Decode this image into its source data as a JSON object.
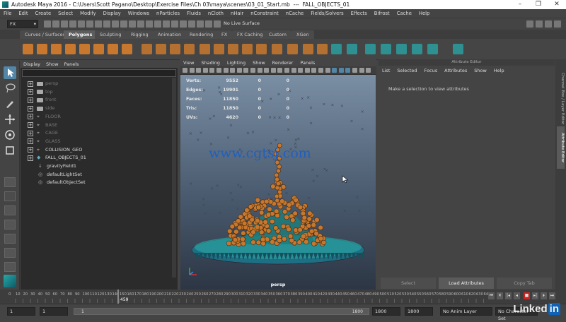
{
  "titlebar": {
    "app": "Autodesk Maya 2016",
    "sep": "-",
    "path": "C:\\Users\\Scott Pagano\\Desktop\\Exercise Files\\Ch 03\\maya\\scenes\\03_01_Start.mb",
    "dash": "---",
    "object": "FALL_OBJECTS_01"
  },
  "menubar": [
    "File",
    "Edit",
    "Create",
    "Select",
    "Modify",
    "Display",
    "Windows",
    "nParticles",
    "Fluids",
    "nCloth",
    "nHair",
    "nConstraint",
    "nCache",
    "Fields/Solvers",
    "Effects",
    "Bifrost",
    "Cache",
    "Help"
  ],
  "statusline": {
    "menuset": "FX",
    "live_surface": "No Live Surface"
  },
  "shelf_tabs": [
    "Curves / Surfaces",
    "Polygons",
    "Sculpting",
    "Rigging",
    "Animation",
    "Rendering",
    "FX",
    "FX Caching",
    "Custom",
    "XGen"
  ],
  "active_shelf_tab": "Polygons",
  "outliner": {
    "menu": [
      "Display",
      "Show",
      "Panels"
    ],
    "items": [
      {
        "label": "persp",
        "dim": true,
        "kind": "camera"
      },
      {
        "label": "top",
        "dim": true,
        "kind": "camera"
      },
      {
        "label": "front",
        "dim": true,
        "kind": "camera"
      },
      {
        "label": "side",
        "dim": true,
        "kind": "camera"
      },
      {
        "label": "FLOOR",
        "dim": true,
        "kind": "group"
      },
      {
        "label": "BASE",
        "dim": true,
        "kind": "group"
      },
      {
        "label": "CAGE",
        "dim": true,
        "kind": "group"
      },
      {
        "label": "GLASS",
        "dim": true,
        "kind": "group"
      },
      {
        "label": "COLLISION_GEO",
        "dim": false,
        "kind": "group"
      },
      {
        "label": "FALL_OBJECTS_01",
        "dim": false,
        "kind": "mesh"
      },
      {
        "label": "gravityField1",
        "dim": false,
        "kind": "field"
      },
      {
        "label": "defaultLightSet",
        "dim": false,
        "kind": "set"
      },
      {
        "label": "defaultObjectSet",
        "dim": false,
        "kind": "set"
      }
    ]
  },
  "viewport": {
    "menu": [
      "View",
      "Shading",
      "Lighting",
      "Show",
      "Renderer",
      "Panels"
    ],
    "hud": [
      {
        "label": "Verts:",
        "v1": "9552",
        "v2": "0",
        "v3": "0"
      },
      {
        "label": "Edges:",
        "v1": "19901",
        "v2": "0",
        "v3": "0"
      },
      {
        "label": "Faces:",
        "v1": "11850",
        "v2": "0",
        "v3": "0"
      },
      {
        "label": "Tris:",
        "v1": "11850",
        "v2": "0",
        "v3": "0"
      },
      {
        "label": "UVs:",
        "v1": "4620",
        "v2": "0",
        "v3": "0"
      }
    ],
    "camera": "persp",
    "watermark": "www.cgtsj.com"
  },
  "attribute_editor": {
    "title": "Attribute Editor",
    "menu": [
      "List",
      "Selected",
      "Focus",
      "Attributes",
      "Show",
      "Help"
    ],
    "message": "Make a selection to view attributes",
    "buttons": [
      "Select",
      "Load Attributes",
      "Copy Tab"
    ]
  },
  "side_tabs": [
    "Channel Box / Layer Editor",
    "Attribute Editor"
  ],
  "timeline": {
    "ticks": [
      "10",
      "20",
      "30",
      "40",
      "50",
      "60",
      "70",
      "80",
      "90",
      "100",
      "110",
      "120",
      "130",
      "140",
      "150",
      "160",
      "170",
      "180",
      "190",
      "200",
      "210",
      "220",
      "230",
      "240",
      "250",
      "260",
      "270",
      "280",
      "290",
      "300",
      "310",
      "320",
      "330",
      "340",
      "350",
      "360",
      "370",
      "380",
      "390",
      "400",
      "410",
      "420",
      "430",
      "440",
      "450",
      "460",
      "470",
      "480",
      "490",
      "500",
      "510",
      "520",
      "530",
      "540",
      "550",
      "560",
      "570",
      "580",
      "590",
      "600",
      "610",
      "620",
      "630",
      "640"
    ],
    "start_label": "0",
    "current_frame": "459",
    "range_start": "1",
    "playback_start": "1",
    "range_slider_start": "1",
    "range_slider_end": "1800",
    "playback_end": "1800",
    "range_end": "1800",
    "anim_layer": "No Anim Layer",
    "char_set": "No Character Set"
  },
  "branding": {
    "linked": "Linked",
    "in": "in"
  },
  "colors": {
    "accent": "#5285a6",
    "viewport_top": "#7a8ea4",
    "viewport_bottom": "#2c3644",
    "object_orange": "#c7782e",
    "base_teal": "#2a9d9d"
  }
}
